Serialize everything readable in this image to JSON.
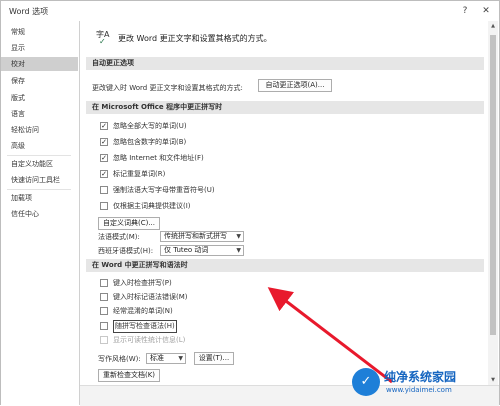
{
  "window": {
    "title": "Word 选项",
    "help": "?",
    "close": "✕"
  },
  "sidebar": {
    "items": [
      "常规",
      "显示",
      "校对",
      "保存",
      "版式",
      "语言",
      "轻松访问",
      "高级",
      "自定义功能区",
      "快速访问工具栏",
      "加载项",
      "信任中心"
    ],
    "active": "校对"
  },
  "main": {
    "header_icon_glyph": "字A",
    "header_text": "更改 Word 更正文字和设置其格式的方式。",
    "autocorrect": {
      "section": "自动更正选项",
      "desc": "更改键入时 Word 更正文字和设置其格式的方式:",
      "button": "自动更正选项(A)..."
    },
    "office_spelling": {
      "section": "在 Microsoft Office 程序中更正拼写时",
      "options": [
        {
          "label": "忽略全部大写的单词(U)",
          "checked": true
        },
        {
          "label": "忽略包含数字的单词(B)",
          "checked": true
        },
        {
          "label": "忽略 Internet 和文件地址(F)",
          "checked": true
        },
        {
          "label": "标记重复单词(R)",
          "checked": true
        },
        {
          "label": "强制法语大写字母带重音符号(U)",
          "checked": false
        },
        {
          "label": "仅根据主词典提供建议(I)",
          "checked": false
        }
      ],
      "dict_button": "自定义词典(C)...",
      "french_label": "法语模式(M):",
      "french_value": "传统拼写和新式拼写",
      "spanish_label": "西班牙语模式(H):",
      "spanish_value": "仅 Tuteo 动词"
    },
    "word_spelling": {
      "section": "在 Word 中更正拼写和语法时",
      "options": [
        {
          "label": "键入时检查拼写(P)",
          "checked": false,
          "disabled": false,
          "boxed": false
        },
        {
          "label": "键入时标记语法错误(M)",
          "checked": false,
          "disabled": false,
          "boxed": false
        },
        {
          "label": "经常混淆的单词(N)",
          "checked": false,
          "disabled": false,
          "boxed": false
        },
        {
          "label": "随拼写检查语法(H)",
          "checked": false,
          "disabled": false,
          "boxed": true
        },
        {
          "label": "显示可读性统计信息(L)",
          "checked": false,
          "disabled": true,
          "boxed": false
        }
      ],
      "style_label": "写作风格(W):",
      "style_value": "标准",
      "settings_button": "设置(T)...",
      "recheck_button": "重新检查文档(K)"
    }
  },
  "watermark": {
    "logo": "✓",
    "title": "纯净系统家园",
    "url": "www.yidaimei.com"
  },
  "colors": {
    "arrow": "#e8192c",
    "brand": "#1565c0",
    "active_item": "#cfcfcf"
  }
}
